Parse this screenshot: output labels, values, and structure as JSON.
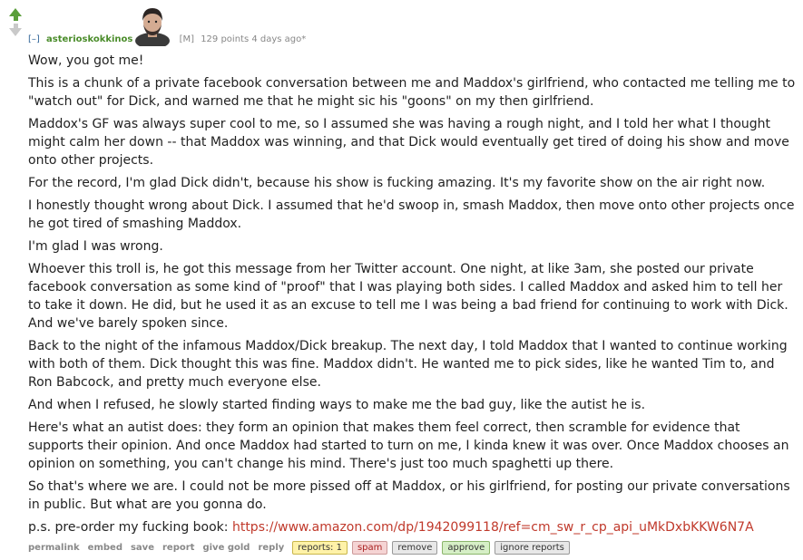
{
  "comment": {
    "collapse": "[–]",
    "author": "asterioskokkinos",
    "flag": "[M]",
    "points": "129 points 4 days ago*",
    "paragraphs": [
      "Wow, you got me!",
      "This is a chunk of a private facebook conversation between me and Maddox's girlfriend, who contacted me telling me to \"watch out\" for Dick, and warned me that he might sic his \"goons\" on my then girlfriend.",
      "Maddox's GF was always super cool to me, so I assumed she was having a rough night, and I told her what I thought might calm her down -- that Maddox was winning, and that Dick would eventually get tired of doing his show and move onto other projects.",
      "For the record, I'm glad Dick didn't, because his show is fucking amazing. It's my favorite show on the air right now.",
      "I honestly thought wrong about Dick. I assumed that he'd swoop in, smash Maddox, then move onto other projects once he got tired of smashing Maddox.",
      "I'm glad I was wrong.",
      "Whoever this troll is, he got this message from her Twitter account. One night, at like 3am, she posted our private facebook conversation as some kind of \"proof\" that I was playing both sides. I called Maddox and asked him to tell her to take it down. He did, but he used it as an excuse to tell me I was being a bad friend for continuing to work with Dick. And we've barely spoken since.",
      "Back to the night of the infamous Maddox/Dick breakup. The next day, I told Maddox that I wanted to continue working with both of them. Dick thought this was fine. Maddox didn't. He wanted me to pick sides, like he wanted Tim to, and Ron Babcock, and pretty much everyone else.",
      "And when I refused, he slowly started finding ways to make me the bad guy, like the autist he is.",
      "Here's what an autist does: they form an opinion that makes them feel correct, then scramble for evidence that supports their opinion. And once Maddox had started to turn on me, I kinda knew it was over. Once Maddox chooses an opinion on something, you can't change his mind. There's just too much spaghetti up there.",
      "So that's where we are. I could not be more pissed off at Maddox, or his girlfriend, for posting our private conversations in public. But what are you gonna do."
    ],
    "ps_text": "p.s. pre-order my fucking book: ",
    "ps_link": "https://www.amazon.com/dp/1942099118/ref=cm_sw_r_cp_api_uMkDxbKKW6N7A"
  },
  "actions": {
    "permalink": "permalink",
    "embed": "embed",
    "save": "save",
    "report": "report",
    "give_gold": "give gold",
    "reply": "reply",
    "reports": "reports: 1",
    "spam": "spam",
    "remove": "remove",
    "approve": "approve",
    "ignore_reports": "ignore reports"
  },
  "colors": {
    "upvote": "#5a9e3a",
    "downvote": "#c9c9c9",
    "author": "#4a8c2a",
    "link": "#c0392b"
  }
}
